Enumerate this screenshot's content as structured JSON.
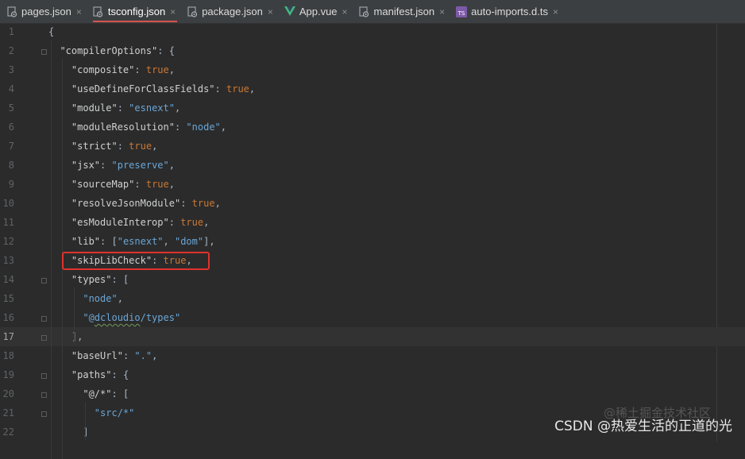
{
  "tabs": [
    {
      "label": "pages.json",
      "icon": "json-gear-icon",
      "active": false
    },
    {
      "label": "tsconfig.json",
      "icon": "json-gear-icon",
      "active": true
    },
    {
      "label": "package.json",
      "icon": "json-gear-icon",
      "active": false
    },
    {
      "label": "App.vue",
      "icon": "vue-icon",
      "active": false
    },
    {
      "label": "manifest.json",
      "icon": "json-gear-icon",
      "active": false
    },
    {
      "label": "auto-imports.d.ts",
      "icon": "typescript-icon",
      "active": false
    }
  ],
  "tab_close_glyph": "×",
  "current_line": 17,
  "lines": [
    {
      "n": "1",
      "text": "{"
    },
    {
      "n": "2",
      "text": "  \"compilerOptions\": {"
    },
    {
      "n": "3",
      "text": "    \"composite\": true,"
    },
    {
      "n": "4",
      "text": "    \"useDefineForClassFields\": true,"
    },
    {
      "n": "5",
      "text": "    \"module\": \"esnext\","
    },
    {
      "n": "6",
      "text": "    \"moduleResolution\": \"node\","
    },
    {
      "n": "7",
      "text": "    \"strict\": true,"
    },
    {
      "n": "8",
      "text": "    \"jsx\": \"preserve\","
    },
    {
      "n": "9",
      "text": "    \"sourceMap\": true,"
    },
    {
      "n": "10",
      "text": "    \"resolveJsonModule\": true,"
    },
    {
      "n": "11",
      "text": "    \"esModuleInterop\": true,"
    },
    {
      "n": "12",
      "text": "    \"lib\": [\"esnext\", \"dom\"],"
    },
    {
      "n": "13",
      "text": "    \"skipLibCheck\": true,"
    },
    {
      "n": "14",
      "text": "    \"types\": ["
    },
    {
      "n": "15",
      "text": "      \"node\","
    },
    {
      "n": "16",
      "text": "      \"@dcloudio/types\""
    },
    {
      "n": "17",
      "text": "    ],"
    },
    {
      "n": "18",
      "text": "    \"baseUrl\": \".\","
    },
    {
      "n": "19",
      "text": "    \"paths\": {"
    },
    {
      "n": "20",
      "text": "      \"@/*\": ["
    },
    {
      "n": "21",
      "text": "        \"src/*\""
    },
    {
      "n": "22",
      "text": "      ]"
    }
  ],
  "watermark": "CSDN @热爱生活的正道的光",
  "watermark_faint": "@稀土掘金技术社区",
  "colors": {
    "background": "#2b2b2b",
    "tabbar": "#3c3f41",
    "key": "#cfd0d1",
    "string": "#6aa6d6",
    "boolean": "#cc7832",
    "highlight_box": "#e0322c",
    "active_tab_underline": "#d9534f"
  }
}
